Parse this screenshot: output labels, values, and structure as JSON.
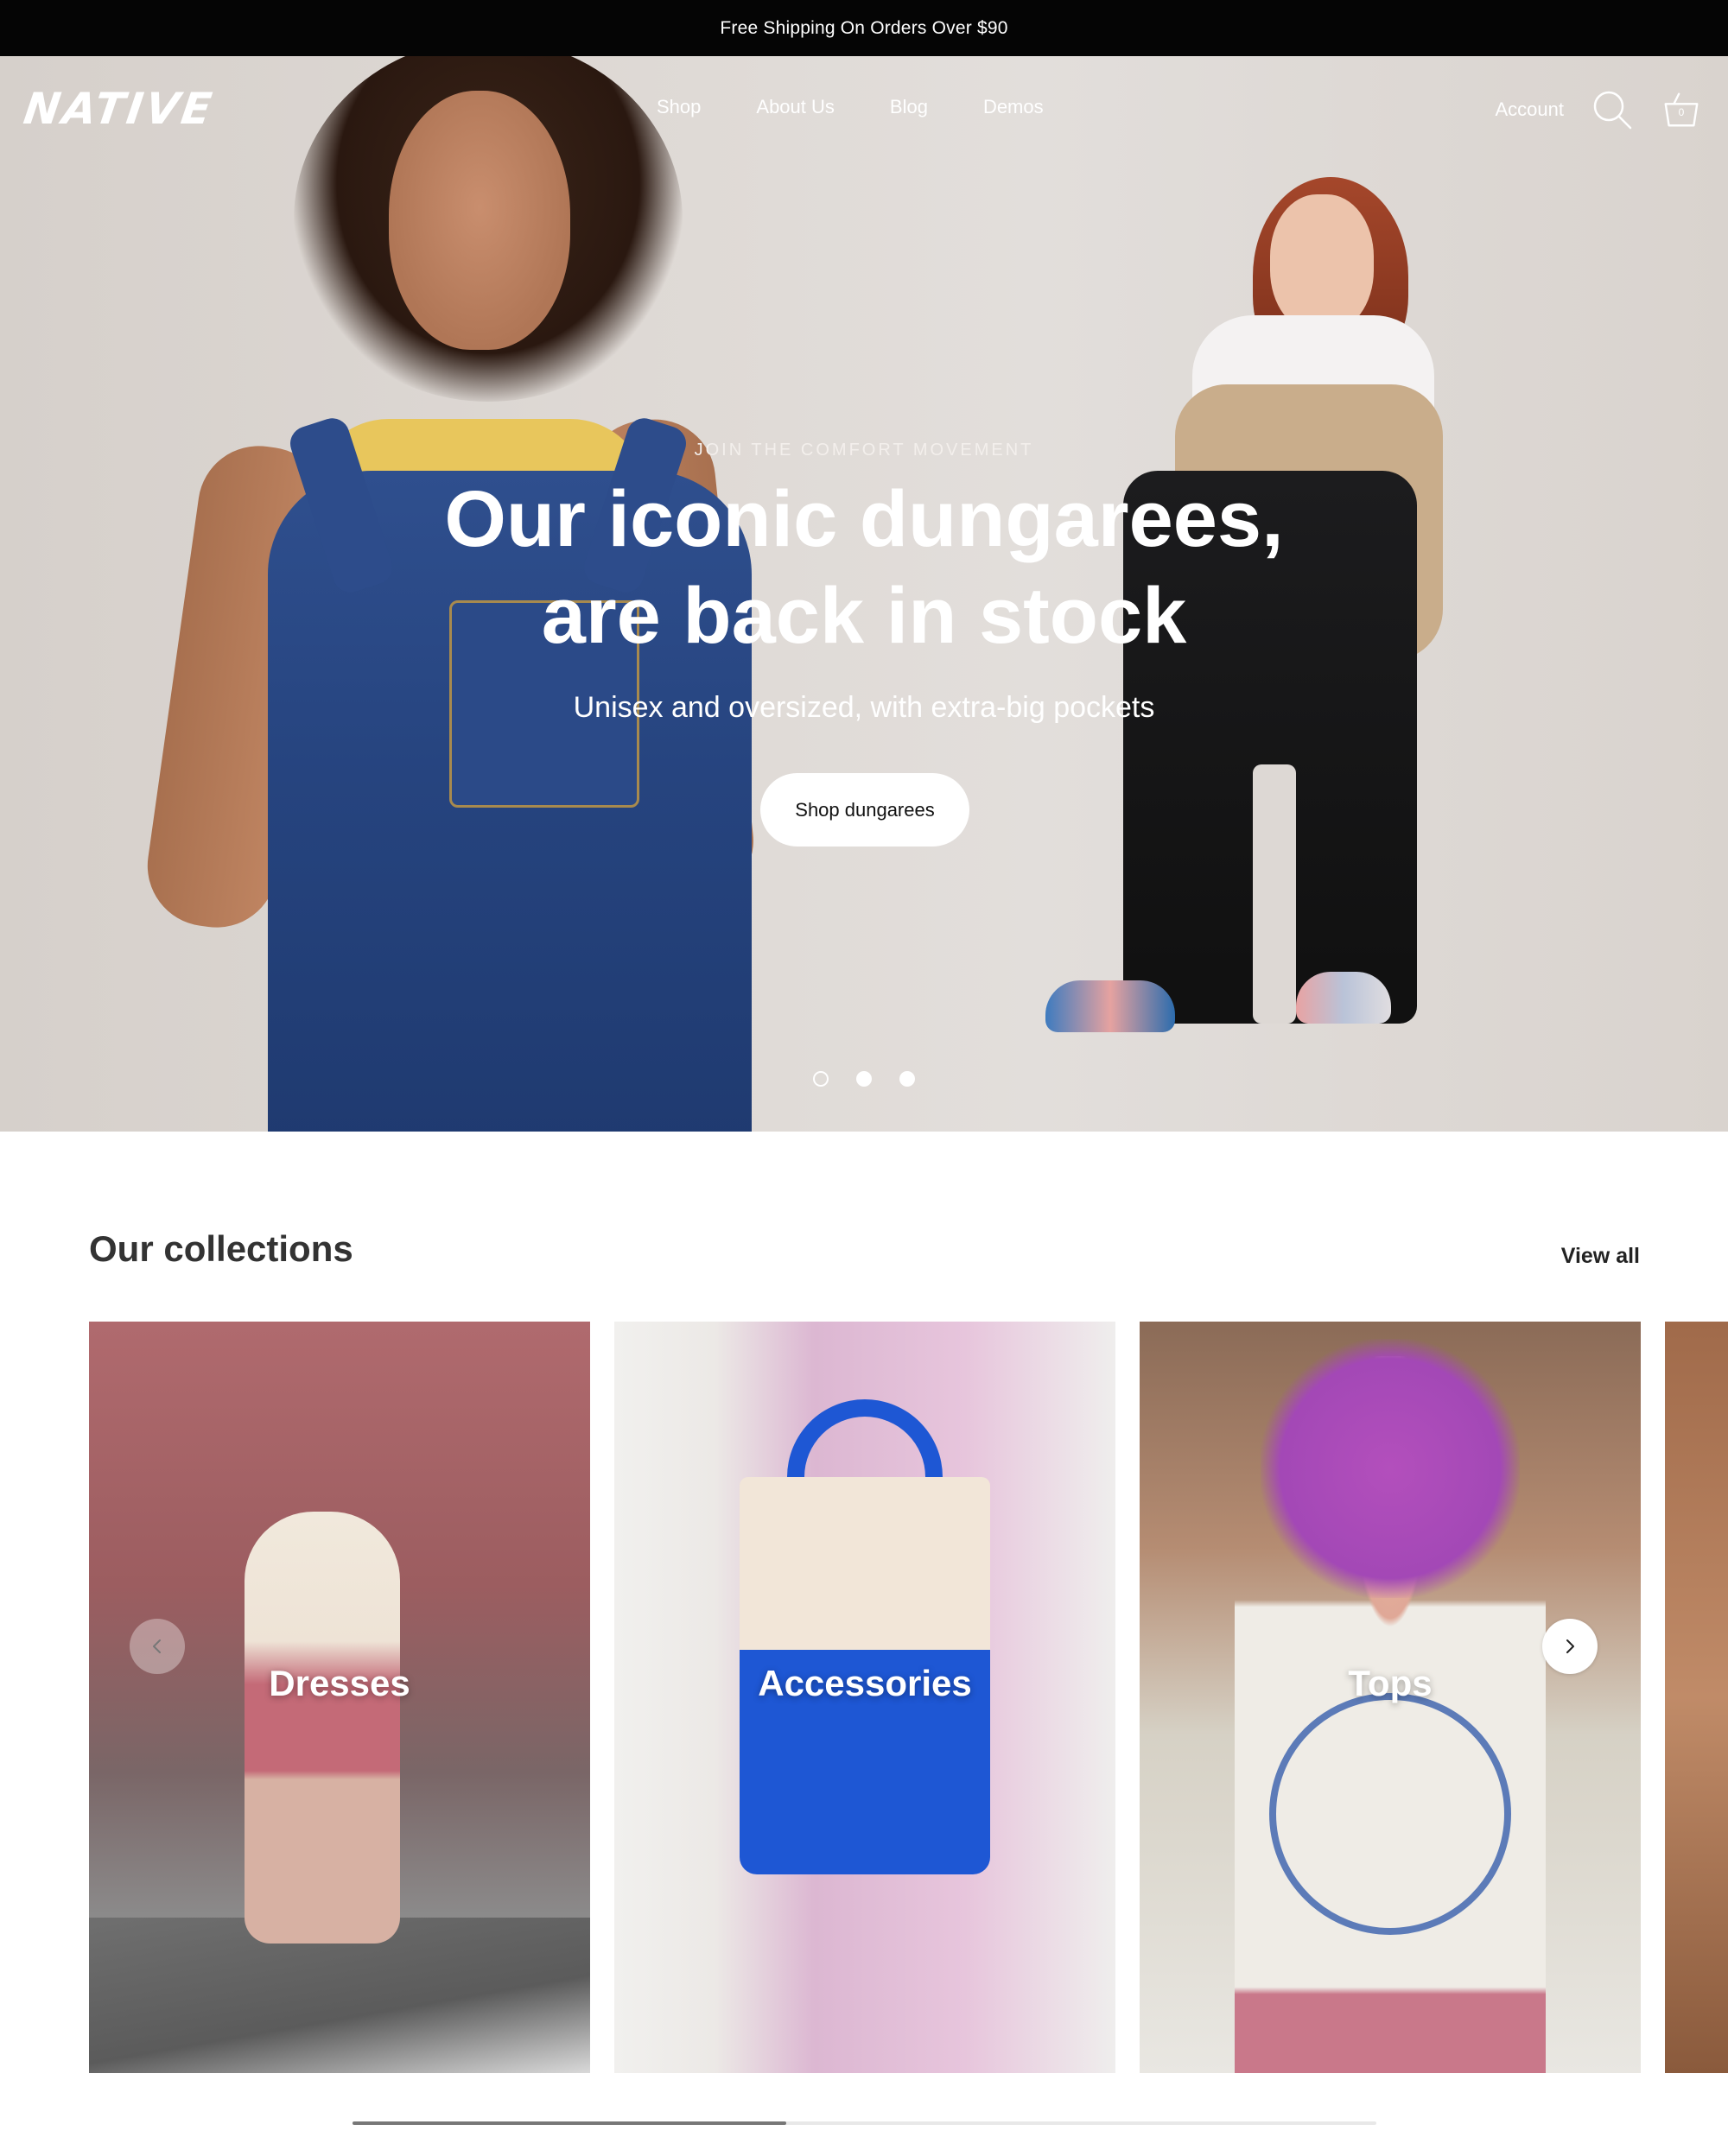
{
  "announcement": "Free Shipping On Orders Over $90",
  "brand": {
    "logo": "NATIVE"
  },
  "nav": {
    "links": [
      "Shop",
      "About Us",
      "Blog",
      "Demos"
    ],
    "account": "Account",
    "cart_count": "0"
  },
  "hero": {
    "eyebrow": "JOIN THE COMFORT MOVEMENT",
    "headline_line1": "Our iconic dungarees,",
    "headline_line2": "are back in stock",
    "subhead": "Unisex and oversized, with extra-big pockets",
    "cta": "Shop dungarees",
    "slide_count": 3,
    "active_slide": 1
  },
  "collections": {
    "title": "Our collections",
    "view_all": "View all",
    "items": [
      {
        "label": "Dresses"
      },
      {
        "label": "Accessories"
      },
      {
        "label": "Tops"
      }
    ]
  },
  "icons": {
    "search": "search-icon",
    "cart": "basket-icon",
    "prev": "chevron-left-icon",
    "next": "chevron-right-icon"
  },
  "colors": {
    "announcement_bg": "#050505",
    "hero_bg": "#ddd7d3",
    "text_dark": "#333333"
  }
}
